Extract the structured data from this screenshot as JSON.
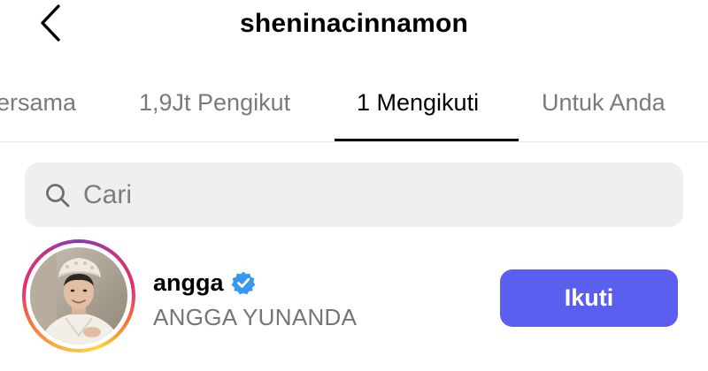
{
  "header": {
    "title": "sheninacinnamon",
    "back_icon": "chevron-left-icon"
  },
  "tabs": [
    {
      "label": "ersama",
      "active": false
    },
    {
      "label": "1,9Jt Pengikut",
      "active": false
    },
    {
      "label": "1 Mengikuti",
      "active": true
    },
    {
      "label": "Untuk Anda",
      "active": false
    }
  ],
  "search": {
    "placeholder": "Cari",
    "value": "",
    "icon": "search-icon"
  },
  "users": [
    {
      "username": "angga",
      "full_name": "ANGGA YUNANDA",
      "verified": true,
      "has_story_ring": true,
      "follow_label": "Ikuti"
    }
  ],
  "colors": {
    "follow_button": "#5b5ff0",
    "verified_badge": "#3897f0",
    "inactive_tab": "#7a7a7a",
    "search_background": "#efefef",
    "secondary_text": "#757575"
  }
}
